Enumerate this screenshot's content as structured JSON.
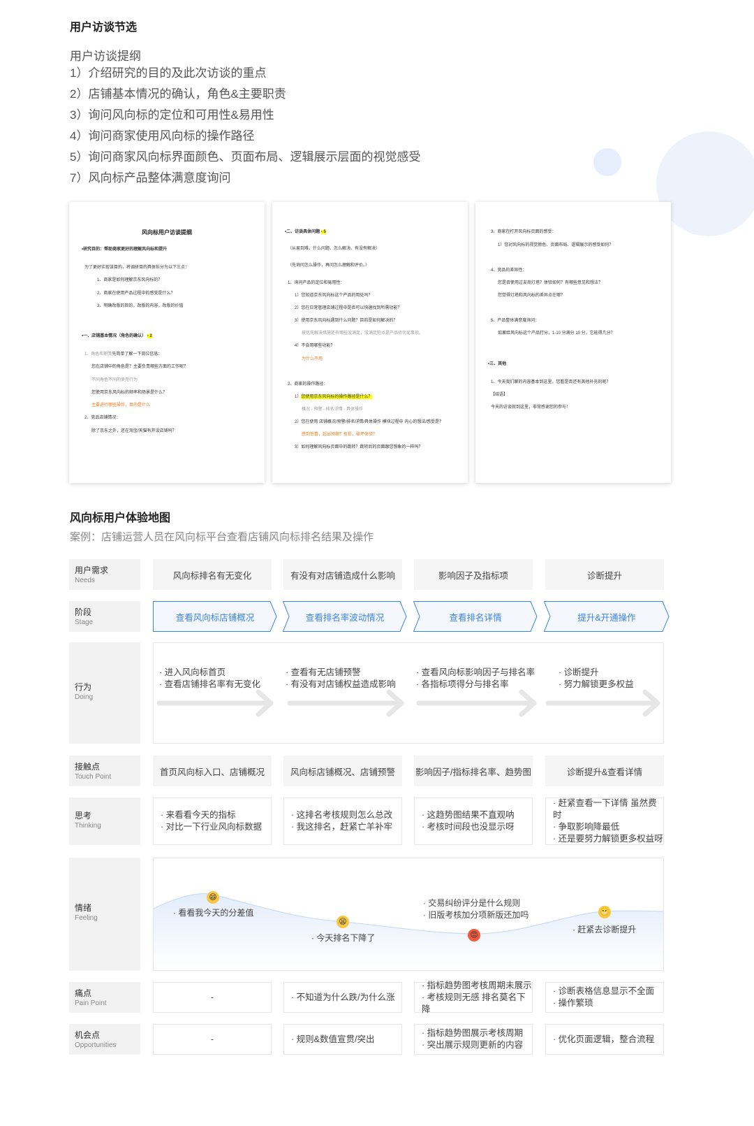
{
  "interview": {
    "title": "用户访谈节选",
    "outline_title": "用户访谈提纲",
    "outline": [
      "1）介绍研究的目的及此次访谈的重点",
      "2）店铺基本情况的确认，角色&主要职责",
      "3）询问风向标的定位和可用性&易用性",
      "4）询问商家使用风向标的操作路径",
      "5）询问商家风向标界面颜色、页面布局、逻辑展示层面的视觉感受",
      "7）风向标产品整体满意度询问"
    ]
  },
  "docs": {
    "doc1": {
      "title": "风向标用户访谈提纲",
      "lines": [
        "•研究目的：帮助商家更好的理解风向标和提升",
        "为了更好实现该目的，将调研目的具体拆分为以下三点：",
        "1、商家是如何理解京东风向标的？",
        "2、商家在使用产品过程中的感受是什么？",
        "3、明确改版的目的，改版的内容，改版的价值",
        "•一、店铺基本情况（角色的确认）",
        "- 2",
        "1、角色和职责",
        "先简单了解一下岗位信息：",
        "您在店铺中的角色是？主要负责哪些方面的工作呢？",
        "不同角色不同的使用行为",
        "您使用京东风向标的频率和场景是什么？",
        "主要进行哪些操作，目的是什么",
        "2、竞品店铺情况：",
        "除了京东之外，还在淘宝/天猫有开设店铺吗？"
      ]
    },
    "doc2": {
      "lines": [
        "•二、访谈具体问题",
        "- 5",
        "（从易到难、什么问题、怎么解决、有没有解决）",
        "（先询问怎么操作，再问怎么理解和评价。）",
        "1、询问产品的定位和易用性：",
        "1）您知道京东风向标这个产品的用处吗？",
        "2）您在日常管理店铺过程中是否可以快速找到所需功能？",
        "3）使用京东风向标遇到什么问题？目前是如何解决的？",
        "按优先解决措施还有哪些没满足，没满足的点是产品待优化事项。",
        "4）不会用哪些功能？",
        "为什么不用",
        "2、商家的操作路径：",
        "1）",
        "您使用京东风向标的操作路径是什么？",
        "概况 - 预警 - 排名详情 - 具体操作",
        "2）您在使用 店铺概况/预警/排名详情/具体操作 模块过程中 内心的想法/感受是？",
        "感到惊喜，超出预期？挫折，破坏体验？",
        "3）如何理解风向标页面中的跳转？跳转后的页面跟您想象的一样吗？"
      ]
    },
    "doc3": {
      "lines": [
        "3、商家在打开风向标页面的感受：",
        "1）您对风向标的视觉颜色、页面布局、逻辑展示的感受如何？",
        "4、竞品的差异性：",
        "您是否使用过友商灯塔？体验如何？有哪些意见和想法？",
        "您觉得灯塔和风向标的差异点在哪？",
        "5、产品整体满意度询问：",
        "如果给风向标这个产品打分，1-10 分满分 10 分，它能得几分？",
        "•三、其他",
        "1、今天我们聊的内容基本到这里，您看是否还有其他补充的呢？",
        "【结语】",
        "今天的访谈就到这里，非常感谢您的参与！"
      ]
    }
  },
  "journey": {
    "title": "风向标用户体验地图",
    "subtitle": "案例：店铺运营人员在风向标平台查看店铺风向标排名结果及操作",
    "labels": {
      "needs": {
        "cn": "用户需求",
        "en": "Needs"
      },
      "stage": {
        "cn": "阶段",
        "en": "Stage"
      },
      "doing": {
        "cn": "行为",
        "en": "Doing"
      },
      "touch": {
        "cn": "接触点",
        "en": "Touch Point"
      },
      "thinking": {
        "cn": "思考",
        "en": "Thinking"
      },
      "feeling": {
        "cn": "情绪",
        "en": "Feeling"
      },
      "pain": {
        "cn": "痛点",
        "en": "Pain Point"
      },
      "opp": {
        "cn": "机会点",
        "en": "Opportunities"
      }
    },
    "needs": [
      "风向标排名有无变化",
      "有没有对店铺造成什么影响",
      "影响因子及指标项",
      "诊断提升"
    ],
    "stages": [
      "查看风向标店铺概况",
      "查看排名率波动情况",
      "查看排名详情",
      "提升&开通操作"
    ],
    "doing": [
      [
        "· 进入风向标首页",
        "· 查看店铺排名率有无变化"
      ],
      [
        "· 查看有无店铺预警",
        "· 有没有对店铺权益造成影响"
      ],
      [
        "· 查看风向标影响因子与排名率",
        "· 各指标项得分与排名率"
      ],
      [
        "· 诊断提升",
        "· 努力解锁更多权益"
      ]
    ],
    "touch": [
      "首页风向标入口、店铺概况",
      "风向标店铺概况、店铺预警",
      "影响因子/指标排名率、趋势图",
      "诊断提升&查看详情"
    ],
    "thinking": [
      [
        "· 来看看今天的指标",
        "· 对比一下行业风向标数据"
      ],
      [
        "· 这排名考核规则怎么总改",
        "· 我这排名，赶紧亡羊补牢"
      ],
      [
        "· 这趋势图结果不直观呐",
        "· 考核时间段也没显示呀"
      ],
      [
        "· 赶紧查看一下详情 虽然费时",
        "· 争取影响降最低",
        "· 还是要努力解锁更多权益呀"
      ]
    ],
    "feeling": {
      "notes": [
        "· 看看我今天的分差值",
        "· 今天排名下降了",
        "· 交易纠纷评分是什么规则",
        "· 旧版考核加分项新版还加吗",
        "· 赶紧去诊断提升"
      ],
      "curve_color": "#c9dcf5",
      "fill_color": "#eef4fc"
    },
    "pain": [
      "-",
      [
        "· 不知道为什么跌/为什么涨"
      ],
      [
        "· 指标趋势图考核周期未展示",
        "· 考核规则无感 排名莫名下降"
      ],
      [
        "· 诊断表格信息显示不全面",
        "· 操作繁琐"
      ]
    ],
    "opp": [
      "-",
      [
        "· 规则&数值宣贯/突出"
      ],
      [
        "· 指标趋势图展示考核周期",
        "· 突出展示规则更新的内容"
      ],
      [
        "· 优化页面逻辑，整合流程"
      ]
    ],
    "colors": {
      "stage_blue": "#3a82e8",
      "highlight": "#ffff00",
      "orange_text": "#f07a1a",
      "emoji_happy": "#f7c744",
      "emoji_angry": "#f25a3c"
    }
  }
}
